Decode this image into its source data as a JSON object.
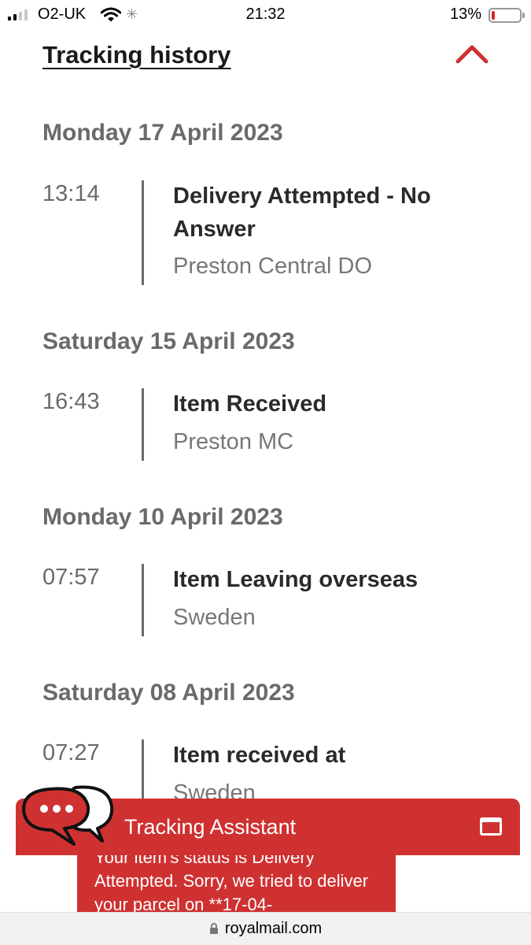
{
  "status_bar": {
    "carrier": "O2-UK",
    "time": "21:32",
    "battery_percent": "13%",
    "battery_level": 0.13,
    "icons": [
      "signal-icon",
      "wifi-icon",
      "activity-spinner-icon",
      "battery-icon"
    ]
  },
  "tracking": {
    "title": "Tracking history",
    "collapse_icon": "chevron-up-icon",
    "accent_color": "#cf3131",
    "days": [
      {
        "date": "Monday 17 April 2023",
        "events": [
          {
            "time": "13:14",
            "title": "Delivery Attempted - No Answer",
            "location": "Preston Central DO"
          }
        ]
      },
      {
        "date": "Saturday 15 April 2023",
        "events": [
          {
            "time": "16:43",
            "title": "Item Received",
            "location": "Preston MC"
          }
        ]
      },
      {
        "date": "Monday 10 April 2023",
        "events": [
          {
            "time": "07:57",
            "title": "Item Leaving overseas",
            "location": "Sweden"
          }
        ]
      },
      {
        "date": "Saturday 08 April 2023",
        "events": [
          {
            "time": "07:27",
            "title": "Item received at",
            "location": "Sweden"
          }
        ]
      }
    ]
  },
  "assistant": {
    "title": "Tracking Assistant",
    "message": "Your item's status is Delivery Attempted. Sorry, we tried to deliver your parcel on **17-04-",
    "icons": [
      "chat-bubbles-icon",
      "window-icon"
    ]
  },
  "browser": {
    "url": "royalmail.com",
    "lock_icon": "lock-icon"
  }
}
